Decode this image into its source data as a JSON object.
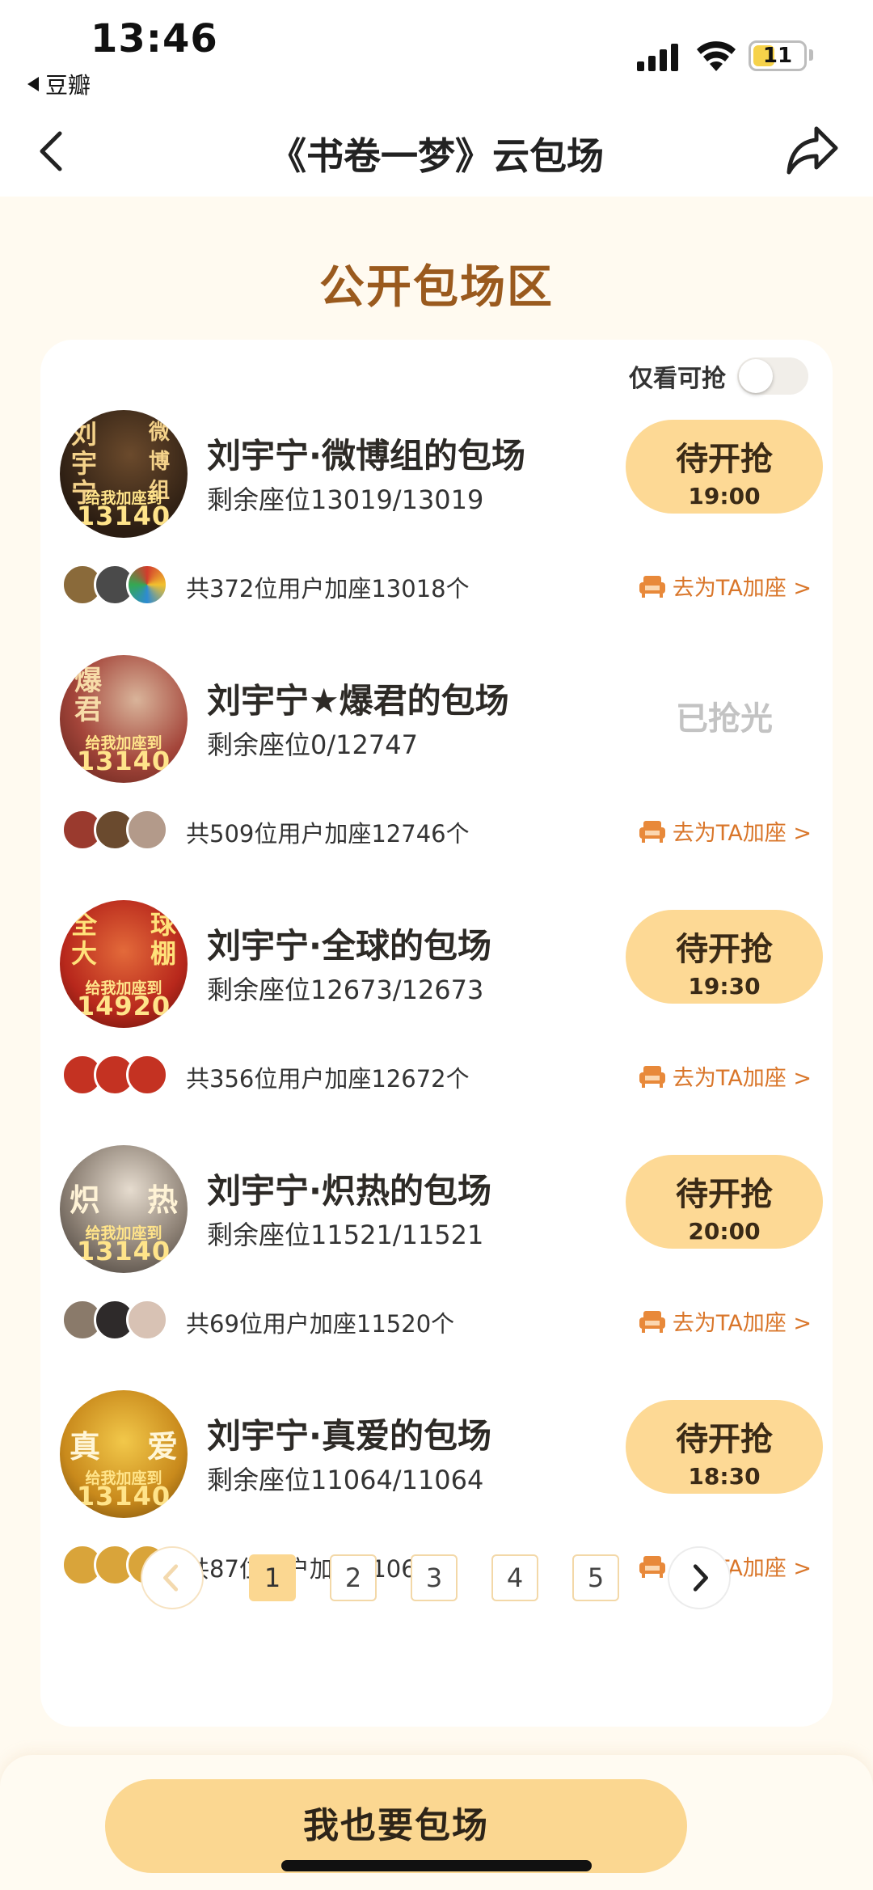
{
  "status_bar": {
    "time": "13:46",
    "back_app": "豆瓣",
    "battery": "11",
    "battery_level": 0.11,
    "icons": [
      "signal-icon",
      "wifi-icon",
      "battery-icon"
    ]
  },
  "nav": {
    "title": "《书卷一梦》云包场",
    "icons": [
      "back-icon",
      "share-icon"
    ]
  },
  "section_title": "公开包场区",
  "filter": {
    "label": "仅看可抢",
    "enabled": false
  },
  "rooms": [
    {
      "name": "刘宇宁·微博组的包场",
      "seats": "剩余座位13019/13019",
      "status": "待开抢",
      "time": "19:00",
      "sold_out": "",
      "users": "共372位用户加座13018个",
      "add_seat": "去为TA加座 >",
      "avatar_left": "刘宇宁",
      "avatar_right": "微博组",
      "avatar_banner": "给我加座到",
      "avatar_number": "13140"
    },
    {
      "name": "刘宇宁★爆君的包场",
      "seats": "剩余座位0/12747",
      "status": "",
      "time": "",
      "sold_out": "已抢光",
      "users": "共509位用户加座12746个",
      "add_seat": "去为TA加座 >",
      "avatar_left": "爆君",
      "avatar_right": "",
      "avatar_banner": "给我加座到",
      "avatar_number": "13140"
    },
    {
      "name": "刘宇宁·全球的包场",
      "seats": "剩余座位12673/12673",
      "status": "待开抢",
      "time": "19:30",
      "sold_out": "",
      "users": "共356位用户加座12672个",
      "add_seat": "去为TA加座 >",
      "avatar_left": "全大",
      "avatar_right": "球棚",
      "avatar_banner": "给我加座到",
      "avatar_number": "14920"
    },
    {
      "name": "刘宇宁·炽热的包场",
      "seats": "剩余座位11521/11521",
      "status": "待开抢",
      "time": "20:00",
      "sold_out": "",
      "users": "共69位用户加座11520个",
      "add_seat": "去为TA加座 >",
      "avatar_left": "炽",
      "avatar_right": "热",
      "avatar_banner": "给我加座到",
      "avatar_number": "13140"
    },
    {
      "name": "刘宇宁·真爱的包场",
      "seats": "剩余座位11064/11064",
      "status": "待开抢",
      "time": "18:30",
      "sold_out": "",
      "users": "共87位用户加座11063个",
      "add_seat": "去为TA加座 >",
      "avatar_left": "真",
      "avatar_right": "爱",
      "avatar_banner": "给我加座到",
      "avatar_number": "13140"
    }
  ],
  "pagination": {
    "pages": [
      "1",
      "2",
      "3",
      "4",
      "5"
    ],
    "current": "1"
  },
  "cta": "我也要包场",
  "colors": {
    "accent": "#fbd791",
    "title_brown": "#9a5a1e",
    "add_seat_orange": "#d9762a",
    "page_bg": "#fffaf0",
    "sold_out_gray": "#c3c3c3"
  }
}
